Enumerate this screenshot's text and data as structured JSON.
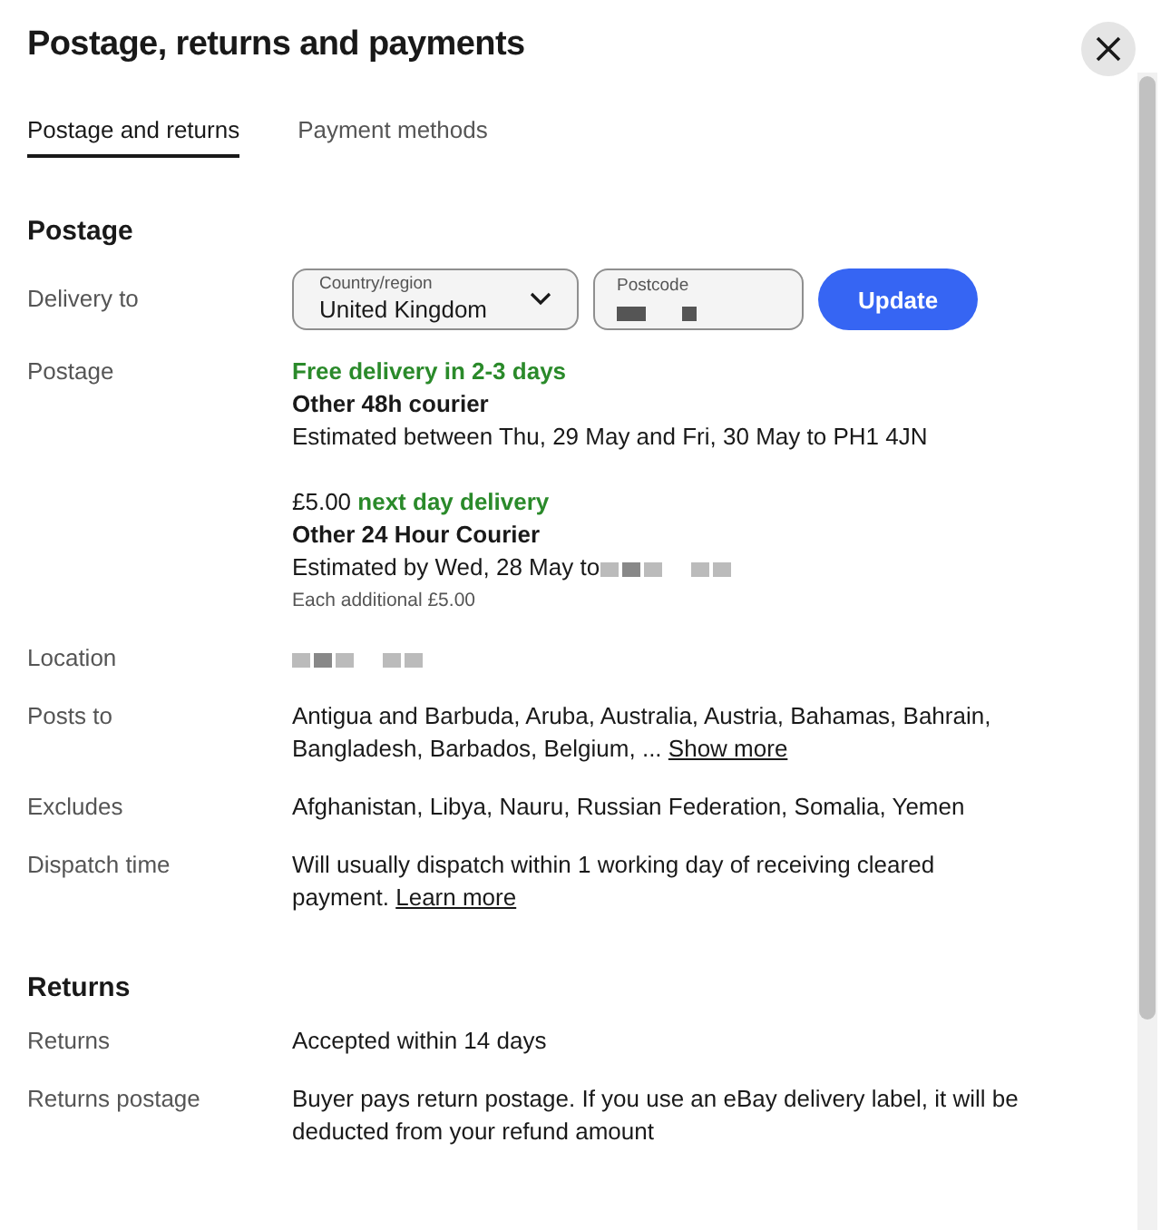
{
  "dialog": {
    "title": "Postage, returns and payments"
  },
  "tabs": [
    {
      "label": "Postage and returns",
      "selected": true
    },
    {
      "label": "Payment methods",
      "selected": false
    }
  ],
  "postage": {
    "heading": "Postage",
    "delivery_to": {
      "label": "Delivery to",
      "country": {
        "label": "Country/region",
        "value": "United Kingdom"
      },
      "postcode": {
        "label": "Postcode",
        "redacted": true
      },
      "button": "Update"
    },
    "options_label": "Postage",
    "options": [
      {
        "headline": "Free delivery in 2-3 days",
        "service": "Other 48h courier",
        "estimate": "Estimated between Thu, 29 May and Fri, 30 May to PH1 4JN"
      },
      {
        "price": "£5.00",
        "headline": "next day delivery",
        "service": "Other 24 Hour Courier",
        "estimate": "Estimated by Wed, 28 May to",
        "estimate_redacted": true,
        "note": "Each additional £5.00"
      }
    ],
    "rows": [
      {
        "kind": "redacted",
        "label": "Location"
      },
      {
        "kind": "text",
        "label": "Posts to",
        "text": "Antigua and Barbuda, Aruba, Australia, Austria, Bahamas, Bahrain, Bangladesh, Barbados, Belgium, ...",
        "link": "Show more"
      },
      {
        "kind": "text",
        "label": "Excludes",
        "text": "Afghanistan, Libya, Nauru, Russian Federation, Somalia, Yemen"
      },
      {
        "kind": "text",
        "label": "Dispatch time",
        "text": "Will usually dispatch within 1 working day of receiving cleared payment.",
        "link": "Learn more"
      }
    ]
  },
  "returns": {
    "heading": "Returns",
    "rows": [
      {
        "kind": "text",
        "label": "Returns",
        "text": "Accepted within 14 days"
      },
      {
        "kind": "text",
        "label": "Returns postage",
        "text": "Buyer pays return postage. If you use an eBay delivery label, it will be deducted from your refund amount"
      }
    ]
  }
}
